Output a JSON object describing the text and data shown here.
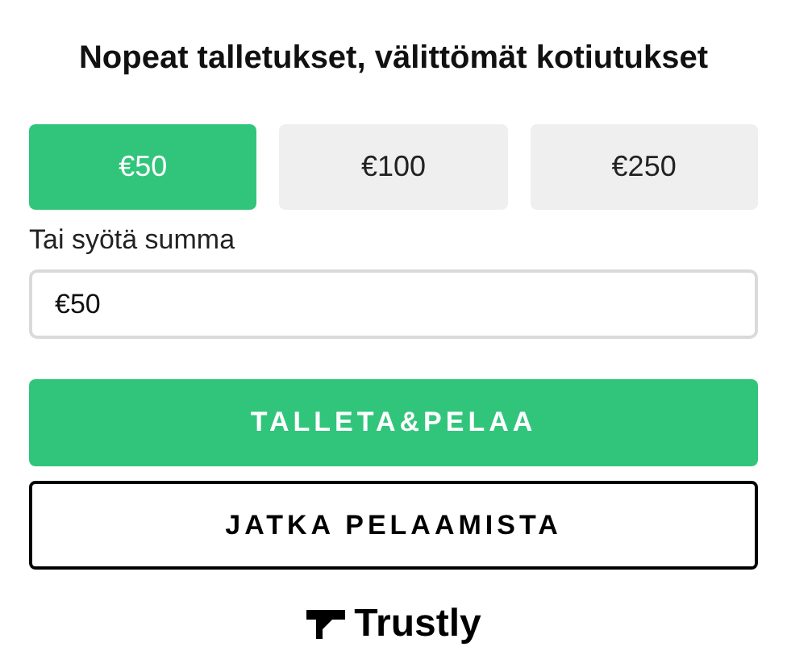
{
  "heading": "Nopeat talletukset, välittömät kotiutukset",
  "amounts": [
    {
      "label": "€50",
      "selected": true
    },
    {
      "label": "€100",
      "selected": false
    },
    {
      "label": "€250",
      "selected": false
    }
  ],
  "custom_amount": {
    "label": "Tai syötä summa",
    "value": "€50"
  },
  "buttons": [
    {
      "label": "TALLETA&PELAA",
      "kind": "primary"
    },
    {
      "label": "JATKA PELAAMISTA",
      "kind": "outline"
    }
  ],
  "provider": {
    "name": "Trustly"
  }
}
